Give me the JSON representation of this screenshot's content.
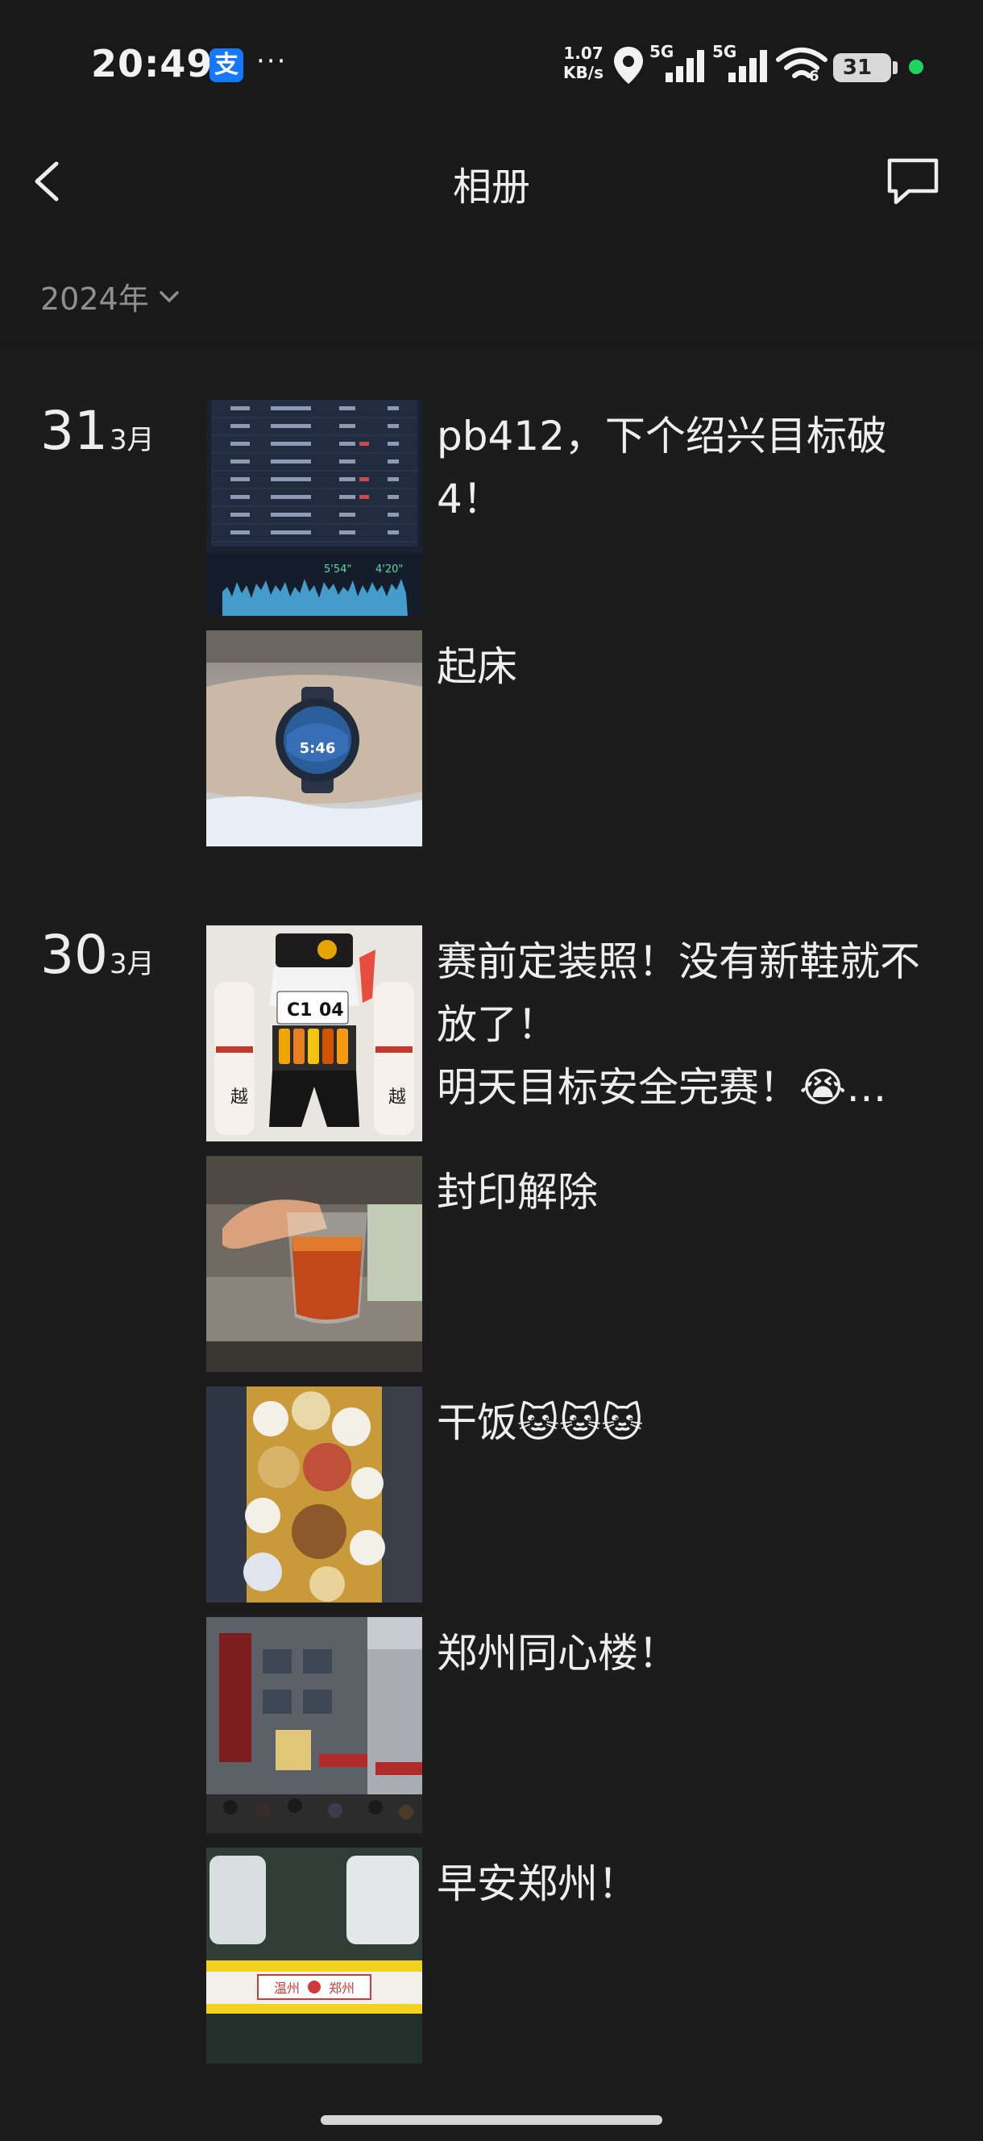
{
  "status_bar": {
    "time": "20:49",
    "alipay_icon": "支",
    "more": "···",
    "speed_value": "1.07",
    "speed_unit": "KB/s",
    "network_1": "5G",
    "network_2": "5G",
    "wifi_badge": "6",
    "battery": "31",
    "icons": [
      "alipay-icon",
      "more-icon",
      "location-icon",
      "signal-5g-icon",
      "signal-5g-icon",
      "wifi-icon",
      "battery-icon",
      "privacy-dot"
    ]
  },
  "header": {
    "title": "相册",
    "back_icon": "chevron-left-icon",
    "comment_icon": "chat-bubble-icon"
  },
  "filter": {
    "year": "2024年",
    "icon": "chevron-down-icon"
  },
  "groups": [
    {
      "day": "31",
      "month": "3月",
      "posts": [
        {
          "caption": "pb412，下个绍兴目标破\n4！",
          "image": "running-stats-screenshot"
        },
        {
          "caption": "起床",
          "image": "wrist-watch-photo"
        }
      ]
    },
    {
      "day": "30",
      "month": "3月",
      "posts": [
        {
          "caption": "赛前定装照！没有新鞋就不\n放了！\n明天目标安全完赛！😭…",
          "image": "race-kit-flatlay"
        },
        {
          "caption": "封印解除",
          "image": "beer-glass-photo"
        },
        {
          "caption": "干饭🐱🐱🐱",
          "image": "dinner-table-photo"
        },
        {
          "caption": "郑州同心楼！",
          "image": "restaurant-building-photo"
        },
        {
          "caption": "早安郑州！",
          "image": "train-car-photo"
        }
      ]
    }
  ],
  "thumb_text": {
    "race_bib": "C1",
    "race_bib_2": "04",
    "watch_time": "5:46",
    "pace_1": "5'54\"",
    "pace_2": "4'20\"",
    "train_sign_1": "温州",
    "train_sign_2": "郑州"
  },
  "colors": {
    "background": "#191919",
    "content_background": "#1c1c1c",
    "text": "#eeeeee",
    "muted": "#8f8f8f",
    "alipay": "#1677ff",
    "privacy_dot": "#1ed65f"
  }
}
